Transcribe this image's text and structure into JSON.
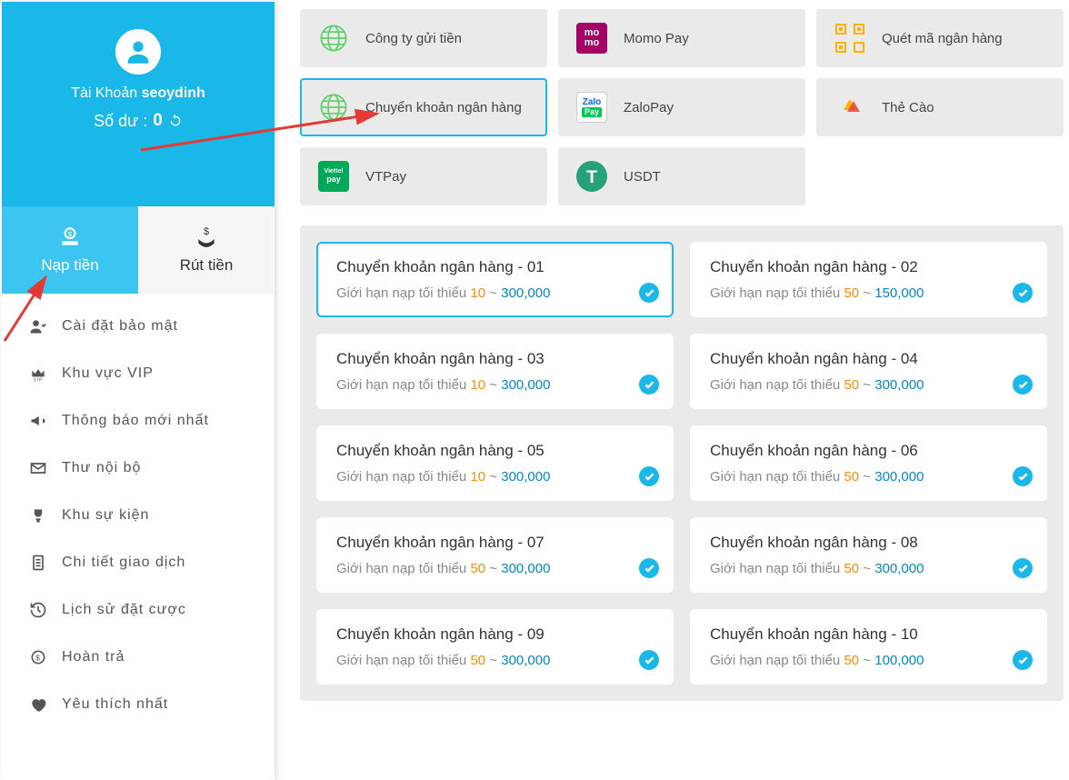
{
  "profile": {
    "account_label": "Tài Khoản",
    "username": "seoydinh",
    "balance_label": "Số dư :",
    "balance_value": "0"
  },
  "tabs": {
    "deposit": "Nạp tiền",
    "withdraw": "Rút tiền"
  },
  "menu": [
    {
      "icon": "security",
      "label": "Cài đặt bảo mật"
    },
    {
      "icon": "vip",
      "label": "Khu vực VIP"
    },
    {
      "icon": "announce",
      "label": "Thông báo mới nhất"
    },
    {
      "icon": "mail",
      "label": "Thư nội bộ"
    },
    {
      "icon": "trophy",
      "label": "Khu sự kiện"
    },
    {
      "icon": "receipt",
      "label": "Chi tiết giao dịch"
    },
    {
      "icon": "history",
      "label": "Lịch sử đặt cược"
    },
    {
      "icon": "coin",
      "label": "Hoàn trả"
    },
    {
      "icon": "heart",
      "label": "Yêu thích nhất"
    }
  ],
  "pay_methods": [
    {
      "id": "company",
      "icon": "globe",
      "label": "Công ty gửi tiền",
      "active": false
    },
    {
      "id": "momo",
      "icon": "momo",
      "label": "Momo Pay",
      "active": false
    },
    {
      "id": "qr",
      "icon": "qr",
      "label": "Quét mã ngân hàng",
      "active": false
    },
    {
      "id": "bank",
      "icon": "globe",
      "label": "Chuyển khoản ngân hàng",
      "active": true
    },
    {
      "id": "zalo",
      "icon": "zalo",
      "label": "ZaloPay",
      "active": false
    },
    {
      "id": "card",
      "icon": "card",
      "label": "Thẻ Cào",
      "active": false
    },
    {
      "id": "vtpay",
      "icon": "vtpay",
      "label": "VTPay",
      "active": false
    },
    {
      "id": "usdt",
      "icon": "usdt",
      "label": "USDT",
      "active": false
    }
  ],
  "bank_label_prefix": "Giới hạn nạp tối thiểu",
  "banks": [
    {
      "title": "Chuyển khoản ngân hàng - 01",
      "min": "10",
      "max": "300,000",
      "selected": true
    },
    {
      "title": "Chuyển khoản ngân hàng - 02",
      "min": "50",
      "max": "150,000",
      "selected": false
    },
    {
      "title": "Chuyển khoản ngân hàng - 03",
      "min": "10",
      "max": "300,000",
      "selected": false
    },
    {
      "title": "Chuyển khoản ngân hàng - 04",
      "min": "50",
      "max": "300,000",
      "selected": false
    },
    {
      "title": "Chuyển khoản ngân hàng - 05",
      "min": "10",
      "max": "300,000",
      "selected": false
    },
    {
      "title": "Chuyển khoản ngân hàng - 06",
      "min": "50",
      "max": "300,000",
      "selected": false
    },
    {
      "title": "Chuyển khoản ngân hàng - 07",
      "min": "50",
      "max": "300,000",
      "selected": false
    },
    {
      "title": "Chuyển khoản ngân hàng - 08",
      "min": "50",
      "max": "300,000",
      "selected": false
    },
    {
      "title": "Chuyển khoản ngân hàng - 09",
      "min": "50",
      "max": "300,000",
      "selected": false
    },
    {
      "title": "Chuyển khoản ngân hàng - 10",
      "min": "50",
      "max": "100,000",
      "selected": false
    }
  ],
  "colors": {
    "primary": "#1ab8e8",
    "min": "#ff8c00",
    "max": "#0088cc"
  }
}
